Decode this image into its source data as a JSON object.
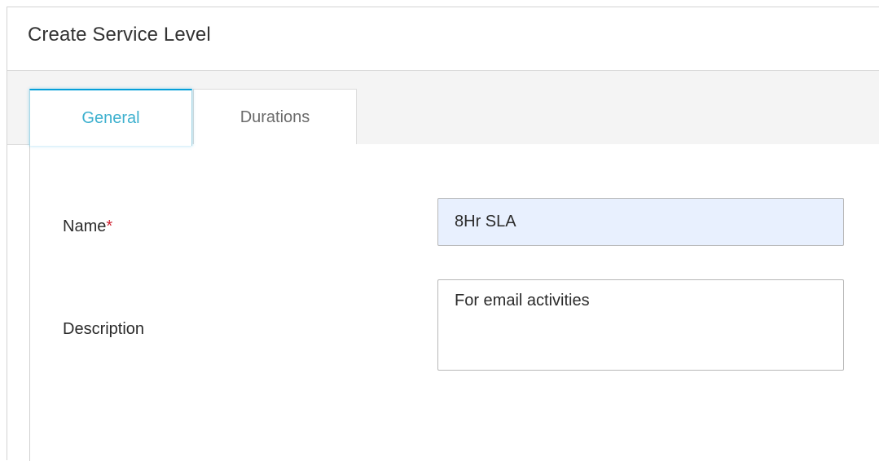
{
  "dialog": {
    "title": "Create Service Level"
  },
  "tabs": [
    {
      "label": "General",
      "active": true
    },
    {
      "label": "Durations",
      "active": false
    }
  ],
  "form": {
    "name": {
      "label": "Name",
      "required_marker": "*",
      "value": "8Hr SLA"
    },
    "description": {
      "label": "Description",
      "value": "For email activities"
    }
  },
  "colors": {
    "active_tab_text": "#3fb1cf",
    "active_tab_accent": "#049fd9",
    "inactive_tab_text": "#6b6b6b",
    "required_marker": "#cf2030",
    "autofill_background": "#e8f0fe"
  }
}
